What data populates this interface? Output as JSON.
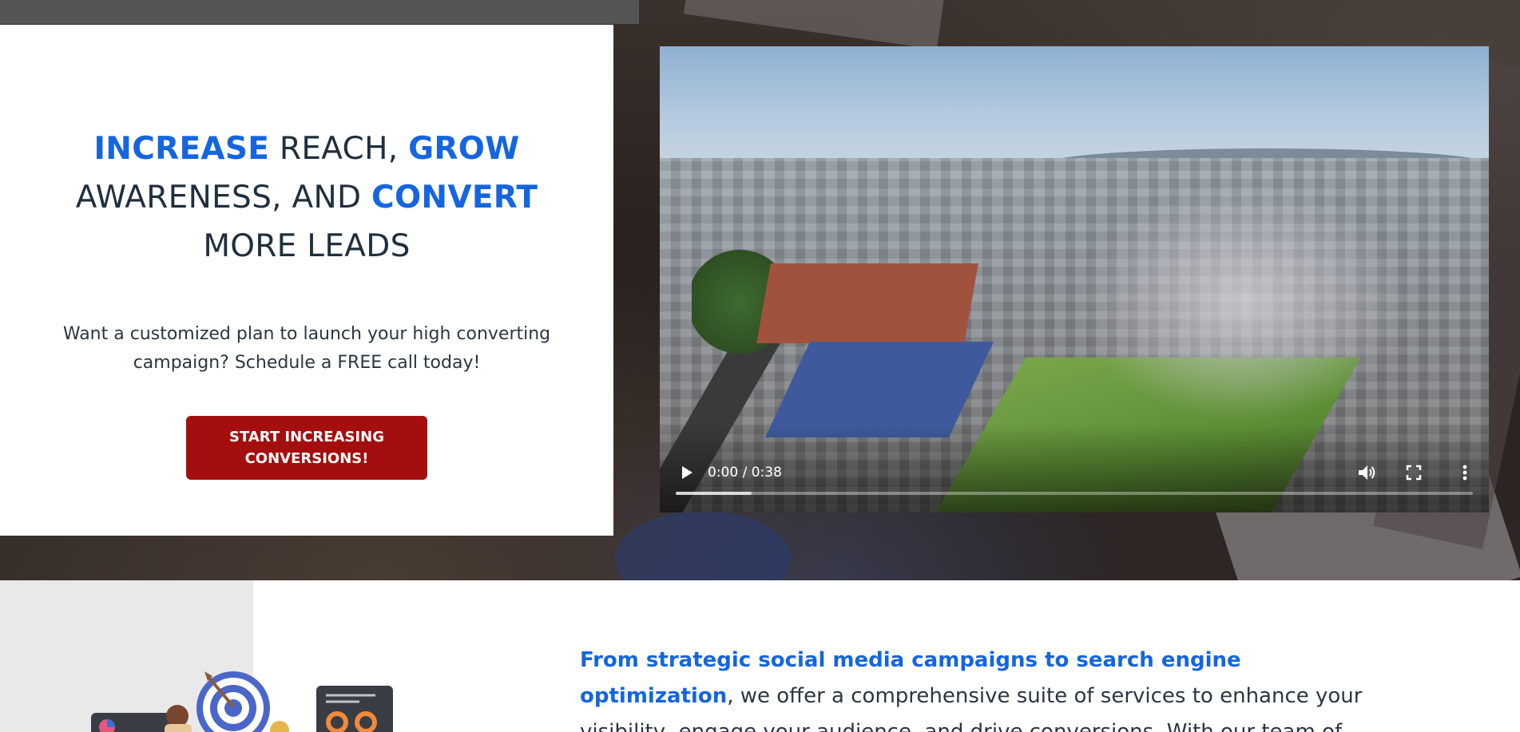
{
  "hero": {
    "title_parts": {
      "w1": "INCREASE",
      "t1": " REACH, ",
      "w2": "GROW",
      "t2": " AWARENESS, AND ",
      "w3": "CONVERT",
      "t3": " MORE LEADS"
    },
    "subtitle": "Want a customized plan to launch your high converting campaign? Schedule a FREE call today!",
    "cta_label": "START INCREASING CONVERSIONS!",
    "accent_color": "#1565e0",
    "cta_color": "#a50e0e"
  },
  "video": {
    "time_display": "0:00 / 0:38",
    "buffered_fraction": 0.095,
    "icons": [
      "play-icon",
      "volume-icon",
      "fullscreen-icon",
      "more-options-icon"
    ]
  },
  "services": {
    "highlight": "From strategic social media campaigns to search engine optimization",
    "body": ", we offer a comprehensive suite of services to enhance your visibility, engage your audience, and drive conversions. With our team of"
  }
}
